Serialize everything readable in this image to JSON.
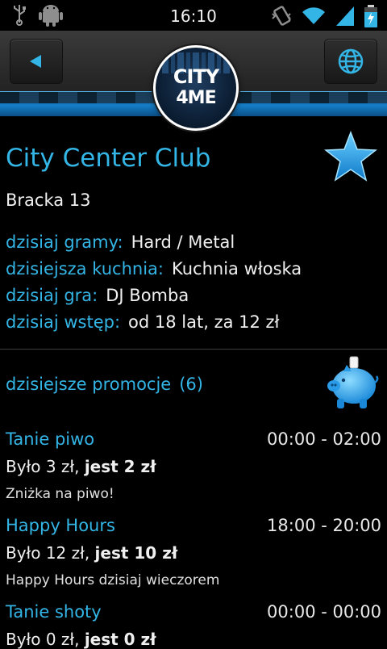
{
  "status_bar": {
    "time": "16:10",
    "icons": [
      "usb-icon",
      "android-icon",
      "vibrate-icon",
      "wifi-icon",
      "signal-icon",
      "battery-charging-icon"
    ]
  },
  "header": {
    "back_icon": "back-arrow-icon",
    "globe_icon": "globe-icon",
    "logo_line1": "CITY",
    "logo_line2": "4ME",
    "accent": "#33b5e5"
  },
  "club": {
    "name": "City Center Club",
    "favorite_icon": "star-icon",
    "address": "Bracka 13",
    "info": [
      {
        "key": "dzisiaj gramy:",
        "value": "Hard / Metal"
      },
      {
        "key": "dzisiejsza kuchnia:",
        "value": "Kuchnia włoska"
      },
      {
        "key": "dzisiaj gra:",
        "value": "DJ Bomba"
      },
      {
        "key": "dzisiaj wstęp:",
        "value": "od 18 lat, za 12 zł"
      }
    ]
  },
  "promotions": {
    "title": "dzisiejsze promocje",
    "count": "(6)",
    "icon": "piggy-bank-icon",
    "items": [
      {
        "name": "Tanie piwo",
        "time": "00:00 - 02:00",
        "was": "Było 3 zł, ",
        "now": "jest 2 zł",
        "desc": "Zniżka na piwo!"
      },
      {
        "name": "Happy Hours",
        "time": "18:00 - 20:00",
        "was": "Było 12 zł, ",
        "now": "jest 10 zł",
        "desc": "Happy Hours dzisiaj wieczorem"
      },
      {
        "name": "Tanie shoty",
        "time": "00:00 - 00:00",
        "was": "Było 0 zł, ",
        "now": "jest 0 zł",
        "desc": ""
      }
    ]
  }
}
